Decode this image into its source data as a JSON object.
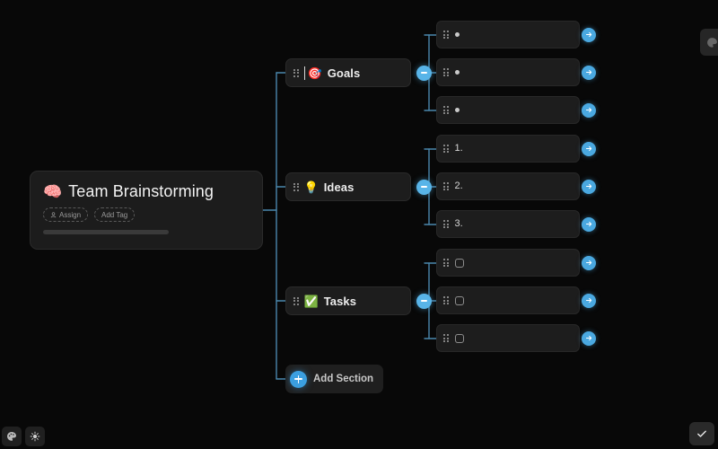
{
  "canvas": {
    "background_color": "#080808",
    "accent_color": "#58b4e8",
    "node_background": "#1d1d1d"
  },
  "root": {
    "emoji": "🧠",
    "emoji_name": "brain-emoji",
    "title": "Team Brainstorming",
    "tags": [
      {
        "label": "Assign",
        "icon": "person-icon"
      },
      {
        "label": "Add Tag",
        "icon": "none"
      }
    ]
  },
  "sections": [
    {
      "emoji": "🎯",
      "emoji_name": "direct-hit-emoji",
      "label": "Goals",
      "collapse_state": "expanded",
      "items": [
        {
          "marker_type": "bullet",
          "marker": "•",
          "text": ""
        },
        {
          "marker_type": "bullet",
          "marker": "•",
          "text": ""
        },
        {
          "marker_type": "bullet",
          "marker": "•",
          "text": ""
        }
      ]
    },
    {
      "emoji": "💡",
      "emoji_name": "light-bulb-emoji",
      "label": "Ideas",
      "collapse_state": "expanded",
      "items": [
        {
          "marker_type": "number",
          "marker": "1.",
          "text": ""
        },
        {
          "marker_type": "number",
          "marker": "2.",
          "text": ""
        },
        {
          "marker_type": "number",
          "marker": "3.",
          "text": ""
        }
      ]
    },
    {
      "emoji": "✅",
      "emoji_name": "check-mark-button-emoji",
      "label": "Tasks",
      "collapse_state": "expanded",
      "items": [
        {
          "marker_type": "checkbox",
          "marker": "",
          "text": ""
        },
        {
          "marker_type": "checkbox",
          "marker": "",
          "text": ""
        },
        {
          "marker_type": "checkbox",
          "marker": "",
          "text": ""
        }
      ]
    }
  ],
  "add_section": {
    "label": "Add Section",
    "icon": "plus-icon"
  },
  "toolbar_bottom_left": [
    {
      "icon": "palette-icon"
    },
    {
      "icon": "brightness-sun-icon"
    }
  ],
  "confirm_button": {
    "icon": "check-icon"
  },
  "top_right_panel": {
    "icon": "palette-icon"
  }
}
